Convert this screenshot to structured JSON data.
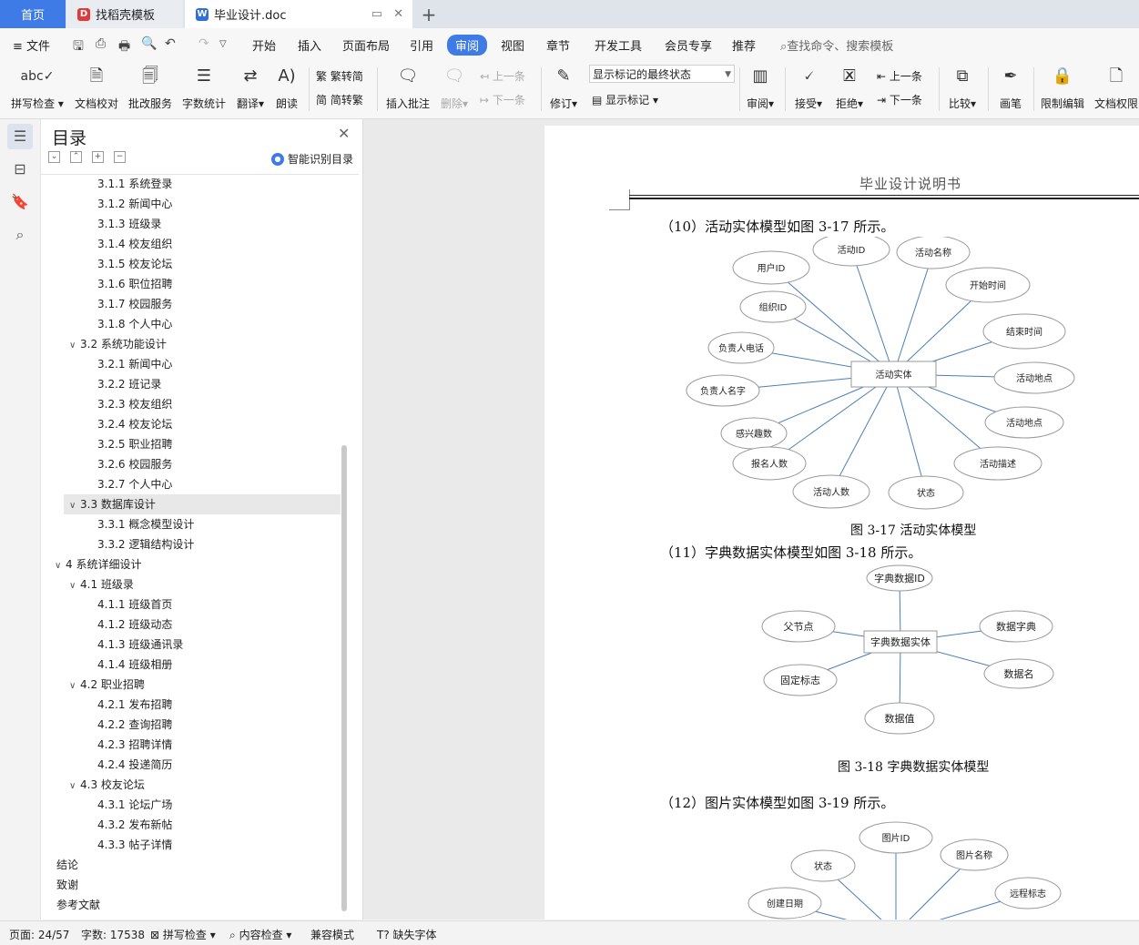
{
  "tabs": {
    "home": "首页",
    "templates": "找稻壳模板",
    "document": "毕业设计.doc",
    "add": "+"
  },
  "menu": {
    "file": "文件",
    "items": [
      "开始",
      "插入",
      "页面布局",
      "引用",
      "审阅",
      "视图",
      "章节",
      "开发工具",
      "会员专享",
      "推荐"
    ],
    "active": "审阅",
    "search_placeholder": "查找命令、搜索模板"
  },
  "ribbon": {
    "spell_check": "拼写检查",
    "doc_proof": "文档校对",
    "correction_service": "批改服务",
    "word_count": "字数统计",
    "translate": "翻译",
    "read_aloud": "朗读",
    "to_traditional": "繁转简",
    "to_simplified": "简转繁",
    "insert_comment": "插入批注",
    "delete": "删除",
    "prev_comment": "上一条",
    "next_comment": "下一条",
    "track_changes": "修订",
    "display_state": "显示标记的最终状态",
    "show_markup": "显示标记",
    "review": "审阅",
    "accept": "接受",
    "reject": "拒绝",
    "prev_change": "上一条",
    "next_change": "下一条",
    "compare": "比较",
    "pen": "画笔",
    "restrict_edit": "限制编辑",
    "doc_permission": "文档权限"
  },
  "nav": {
    "title": "目录",
    "smart_toc": "智能识别目录",
    "items": [
      {
        "label": "3.1.1  系统登录",
        "level": 3
      },
      {
        "label": "3.1.2  新闻中心",
        "level": 3
      },
      {
        "label": "3.1.3  班级录",
        "level": 3
      },
      {
        "label": "3.1.4  校友组织",
        "level": 3
      },
      {
        "label": "3.1.5  校友论坛",
        "level": 3
      },
      {
        "label": "3.1.6  职位招聘",
        "level": 3
      },
      {
        "label": "3.1.7  校园服务",
        "level": 3
      },
      {
        "label": "3.1.8  个人中心",
        "level": 3
      },
      {
        "label": "3.2  系统功能设计",
        "level": 2,
        "toggle": "∨"
      },
      {
        "label": "3.2.1  新闻中心",
        "level": 3
      },
      {
        "label": "3.2.2  班记录",
        "level": 3
      },
      {
        "label": "3.2.3  校友组织",
        "level": 3
      },
      {
        "label": "3.2.4  校友论坛",
        "level": 3
      },
      {
        "label": "3.2.5  职业招聘",
        "level": 3
      },
      {
        "label": "3.2.6  校园服务",
        "level": 3
      },
      {
        "label": "3.2.7  个人中心",
        "level": 3
      },
      {
        "label": "3.3  数据库设计",
        "level": 2,
        "toggle": "∨",
        "selected": true
      },
      {
        "label": "3.3.1  概念模型设计",
        "level": 3
      },
      {
        "label": "3.3.2  逻辑结构设计",
        "level": 3
      },
      {
        "label": "4  系统详细设计",
        "level": 1,
        "toggle": "∨"
      },
      {
        "label": "4.1  班级录",
        "level": 2,
        "toggle": "∨"
      },
      {
        "label": "4.1.1  班级首页",
        "level": 3
      },
      {
        "label": "4.1.2  班级动态",
        "level": 3
      },
      {
        "label": "4.1.3  班级通讯录",
        "level": 3
      },
      {
        "label": "4.1.4  班级相册",
        "level": 3
      },
      {
        "label": "4.2  职业招聘",
        "level": 2,
        "toggle": "∨"
      },
      {
        "label": "4.2.1  发布招聘",
        "level": 3
      },
      {
        "label": "4.2.2  查询招聘",
        "level": 3
      },
      {
        "label": "4.2.3  招聘详情",
        "level": 3
      },
      {
        "label": "4.2.4  投递简历",
        "level": 3
      },
      {
        "label": "4.3  校友论坛",
        "level": 2,
        "toggle": "∨"
      },
      {
        "label": "4.3.1  论坛广场",
        "level": 3
      },
      {
        "label": "4.3.2  发布新帖",
        "level": 3
      },
      {
        "label": "4.3.3  帖子详情",
        "level": 3
      },
      {
        "label": "结论",
        "level": 1
      },
      {
        "label": "致谢",
        "level": 1
      },
      {
        "label": "参考文献",
        "level": 1
      }
    ]
  },
  "document": {
    "header": "毕业设计说明书",
    "para10": "（10）活动实体模型如图 3-17 所示。",
    "caption17": "图 3-17  活动实体模型",
    "para11": "（11）字典数据实体模型如图 3-18 所示。",
    "caption18": "图 3-18  字典数据实体模型",
    "para12": "（12）图片实体模型如图 3-19 所示。",
    "diagram17": {
      "entity": "活动实体",
      "attributes": [
        "活动ID",
        "活动名称",
        "用户ID",
        "开始时间",
        "组织ID",
        "结束时间",
        "负责人电话",
        "活动地点",
        "负责人名字",
        "活动地点",
        "感兴趣数",
        "活动描述",
        "报名人数",
        "活动人数",
        "状态"
      ]
    },
    "diagram18": {
      "entity": "字典数据实体",
      "attributes": [
        "字典数据ID",
        "父节点",
        "数据字典",
        "固定标志",
        "数据名",
        "数据值"
      ]
    },
    "diagram19": {
      "attributes": [
        "图片ID",
        "状态",
        "图片名称",
        "创建日期",
        "远程标志"
      ]
    }
  },
  "status": {
    "page": "页面: 24/57",
    "words": "字数: 17538",
    "spell": "拼写检查",
    "content_check": "内容检查",
    "compat": "兼容模式",
    "missing_font": "缺失字体"
  }
}
